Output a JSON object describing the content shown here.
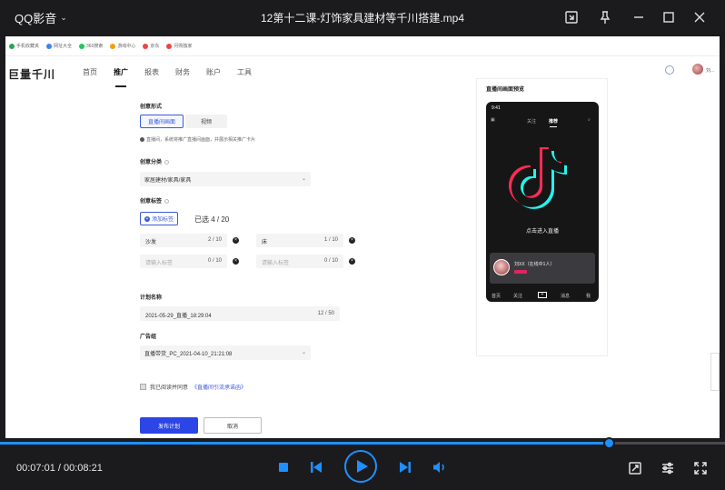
{
  "app": {
    "brand": "QQ影音",
    "file_title": "12第十二课-灯饰家具建材等千川搭建.mp4"
  },
  "video": {
    "bookmarks": [
      "手机收藏夹",
      "网址大全",
      "360搜索",
      "游戏中心",
      "京东",
      "月购独家"
    ],
    "site": {
      "logo": "巨量千川",
      "nav": [
        "首页",
        "推广",
        "报表",
        "财务",
        "账户",
        "工具"
      ],
      "active_nav_index": 1,
      "user_name": "刘..."
    },
    "form": {
      "creative_form_label": "创意形式",
      "creative_form_options": [
        "直播间画面",
        "视频"
      ],
      "creative_form_hint": "直播间，系统将推广直播间画面，并展示相关推广卡片",
      "creative_category_label": "创意分类",
      "creative_category_value": "家居建材/家具/家具",
      "creative_tag_label": "创意标签",
      "add_tag_label": "添加标签",
      "tags_selected_prefix": "已选",
      "tags_selected": "4 / 20",
      "tags": [
        {
          "text": "沙发",
          "count": "2 / 10",
          "placeholder": false
        },
        {
          "text": "床",
          "count": "1 / 10",
          "placeholder": false
        },
        {
          "text": "请输入标签",
          "count": "0 / 10",
          "placeholder": true
        },
        {
          "text": "请输入标签",
          "count": "0 / 10",
          "placeholder": true
        }
      ],
      "plan_name_label": "计划名称",
      "plan_name_value": "2021-05-29_直播_18:29:04",
      "plan_name_count": "12 / 50",
      "ad_group_label": "广告组",
      "ad_group_value": "直播带货_PC_2021-04-10_21:21:08",
      "agree_text": "我已阅读并同意",
      "agree_link": "《直播间引流承诺函》",
      "submit_label": "发布计划",
      "cancel_label": "取消"
    },
    "preview": {
      "title": "直播间画面预览",
      "status_time": "9:41",
      "tabs": [
        "关注",
        "推荐"
      ],
      "enter_live": "点击进入直播",
      "card_name": "刘XX（在线中1人）",
      "bottom_tabs": [
        "首页",
        "关注",
        "+",
        "消息",
        "我"
      ]
    }
  },
  "player": {
    "progress": 0.84,
    "time_current": "00:07:01",
    "time_total": "00:08:21",
    "time_separator": " / ",
    "accent": "#1e90ff"
  }
}
